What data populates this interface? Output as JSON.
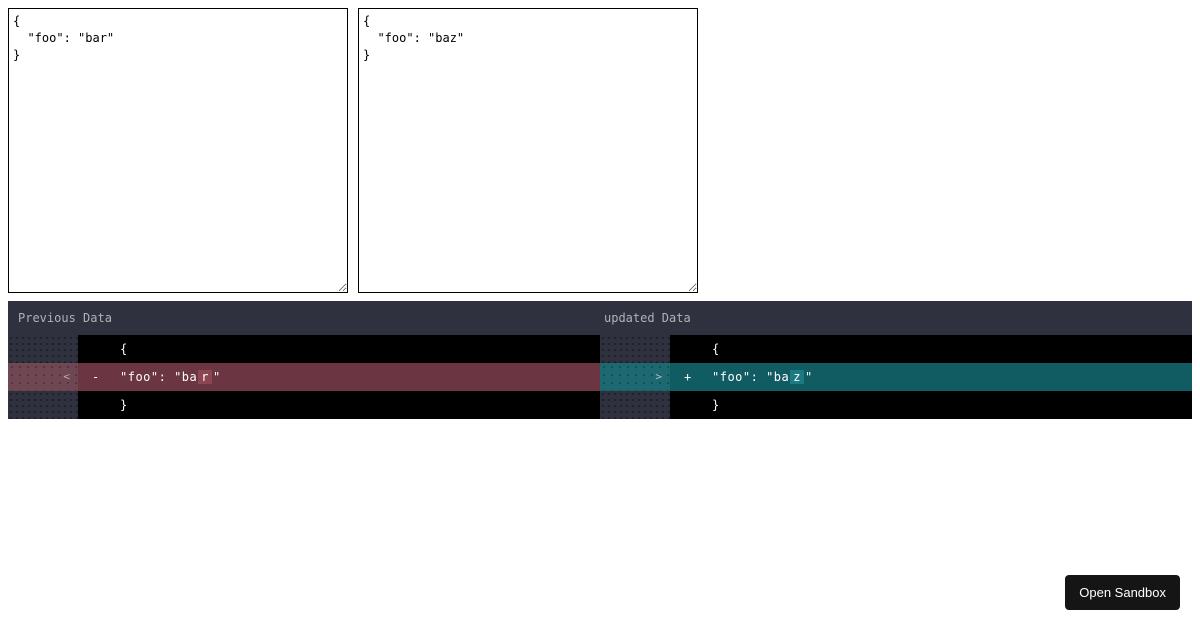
{
  "textareas": {
    "left": "{\n  \"foo\": \"bar\"\n}",
    "right": "{\n  \"foo\": \"baz\"\n}"
  },
  "diff": {
    "headers": {
      "left": "Previous Data",
      "right": "updated Data"
    },
    "rows": {
      "open_brace": "{",
      "close_brace": "}",
      "minus_sign": "-",
      "plus_sign": "+",
      "changed_prefix": "\"foo\": \"ba",
      "changed_suffix": "\"",
      "changed_char_left": "r",
      "changed_char_right": "z",
      "left_gutter_num": "<",
      "right_gutter_num": ">"
    }
  },
  "button": {
    "sandbox": "Open Sandbox"
  }
}
